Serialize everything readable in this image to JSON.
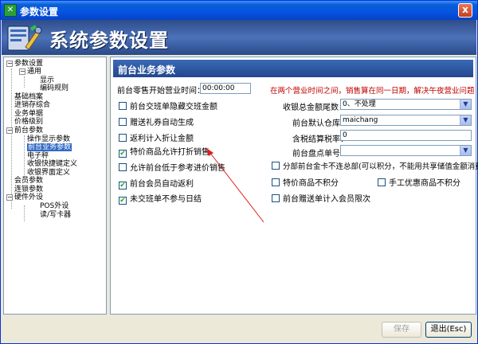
{
  "window": {
    "title": "参数设置",
    "app_icon": "app-icon",
    "close_label": "x"
  },
  "banner": {
    "title": "系统参数设置"
  },
  "tree": [
    {
      "label": "参数设置",
      "expander": "−"
    },
    {
      "label": "通用",
      "expander": "−"
    },
    {
      "label": "显示",
      "expander": ""
    },
    {
      "label": "编码规则",
      "expander": ""
    },
    {
      "label": "基础档案",
      "expander": ""
    },
    {
      "label": "进销存综合",
      "expander": ""
    },
    {
      "label": "业务单据",
      "expander": ""
    },
    {
      "label": "价格级别",
      "expander": ""
    },
    {
      "label": "前台参数",
      "expander": "−"
    },
    {
      "label": "操作显示参数",
      "expander": ""
    },
    {
      "label": "前台业务参数",
      "expander": ""
    },
    {
      "label": "电子秤",
      "expander": ""
    },
    {
      "label": "收银快捷键定义",
      "expander": ""
    },
    {
      "label": "收银界面定义",
      "expander": ""
    },
    {
      "label": "会员参数",
      "expander": ""
    },
    {
      "label": "连锁参数",
      "expander": ""
    },
    {
      "label": "硬件外设",
      "expander": "−"
    },
    {
      "label": "POS外设",
      "expander": ""
    },
    {
      "label": "读/写卡器",
      "expander": ""
    }
  ],
  "panel": {
    "title": "前台业务参数",
    "start_time_label": "前台零售开始营业时间：",
    "start_time_value": "00:00:00",
    "hint": "在两个营业时间之间，销售算在同一日期，解决午夜营业问题",
    "left_options": [
      {
        "label": "前台交班单隐藏交班金额",
        "checked": false
      },
      {
        "label": "赠送礼券自动生成",
        "checked": false
      },
      {
        "label": "返利计入折让金额",
        "checked": false
      },
      {
        "label": "特价商品允许打折销售",
        "checked": true
      },
      {
        "label": "允许前台低于参考进价销售",
        "checked": false
      },
      {
        "label": "前台会员自动返利",
        "checked": true
      },
      {
        "label": "未交班单不参与日结",
        "checked": true
      }
    ],
    "checked_mark": "✔",
    "rounding_label": "收银总金额尾数：",
    "rounding_value": "0、不处理",
    "warehouse_label": "前台默认仓库：",
    "warehouse_value": "maichang",
    "tax_label": "含税结算税率：",
    "tax_value": "0",
    "inventory_label": "前台盘点单号：",
    "inventory_value": "",
    "right_options": [
      {
        "label": "分部前台金卡不连总部(可以积分，不能用共享储值金额消费)",
        "checked": false
      },
      {
        "label": "特价商品不积分",
        "checked": false
      },
      {
        "label": "手工优惠商品不积分",
        "checked": false
      },
      {
        "label": "前台赠送单计入会员限次",
        "checked": false
      }
    ],
    "dropdown_arrow": "▼"
  },
  "buttons": {
    "save": "保存",
    "save_icon": "save-icon",
    "exit": "退出(Esc)"
  },
  "colors": {
    "accent": "#23478f",
    "hint": "#c00000",
    "check": "#21a121",
    "annotation": "#e02020"
  }
}
